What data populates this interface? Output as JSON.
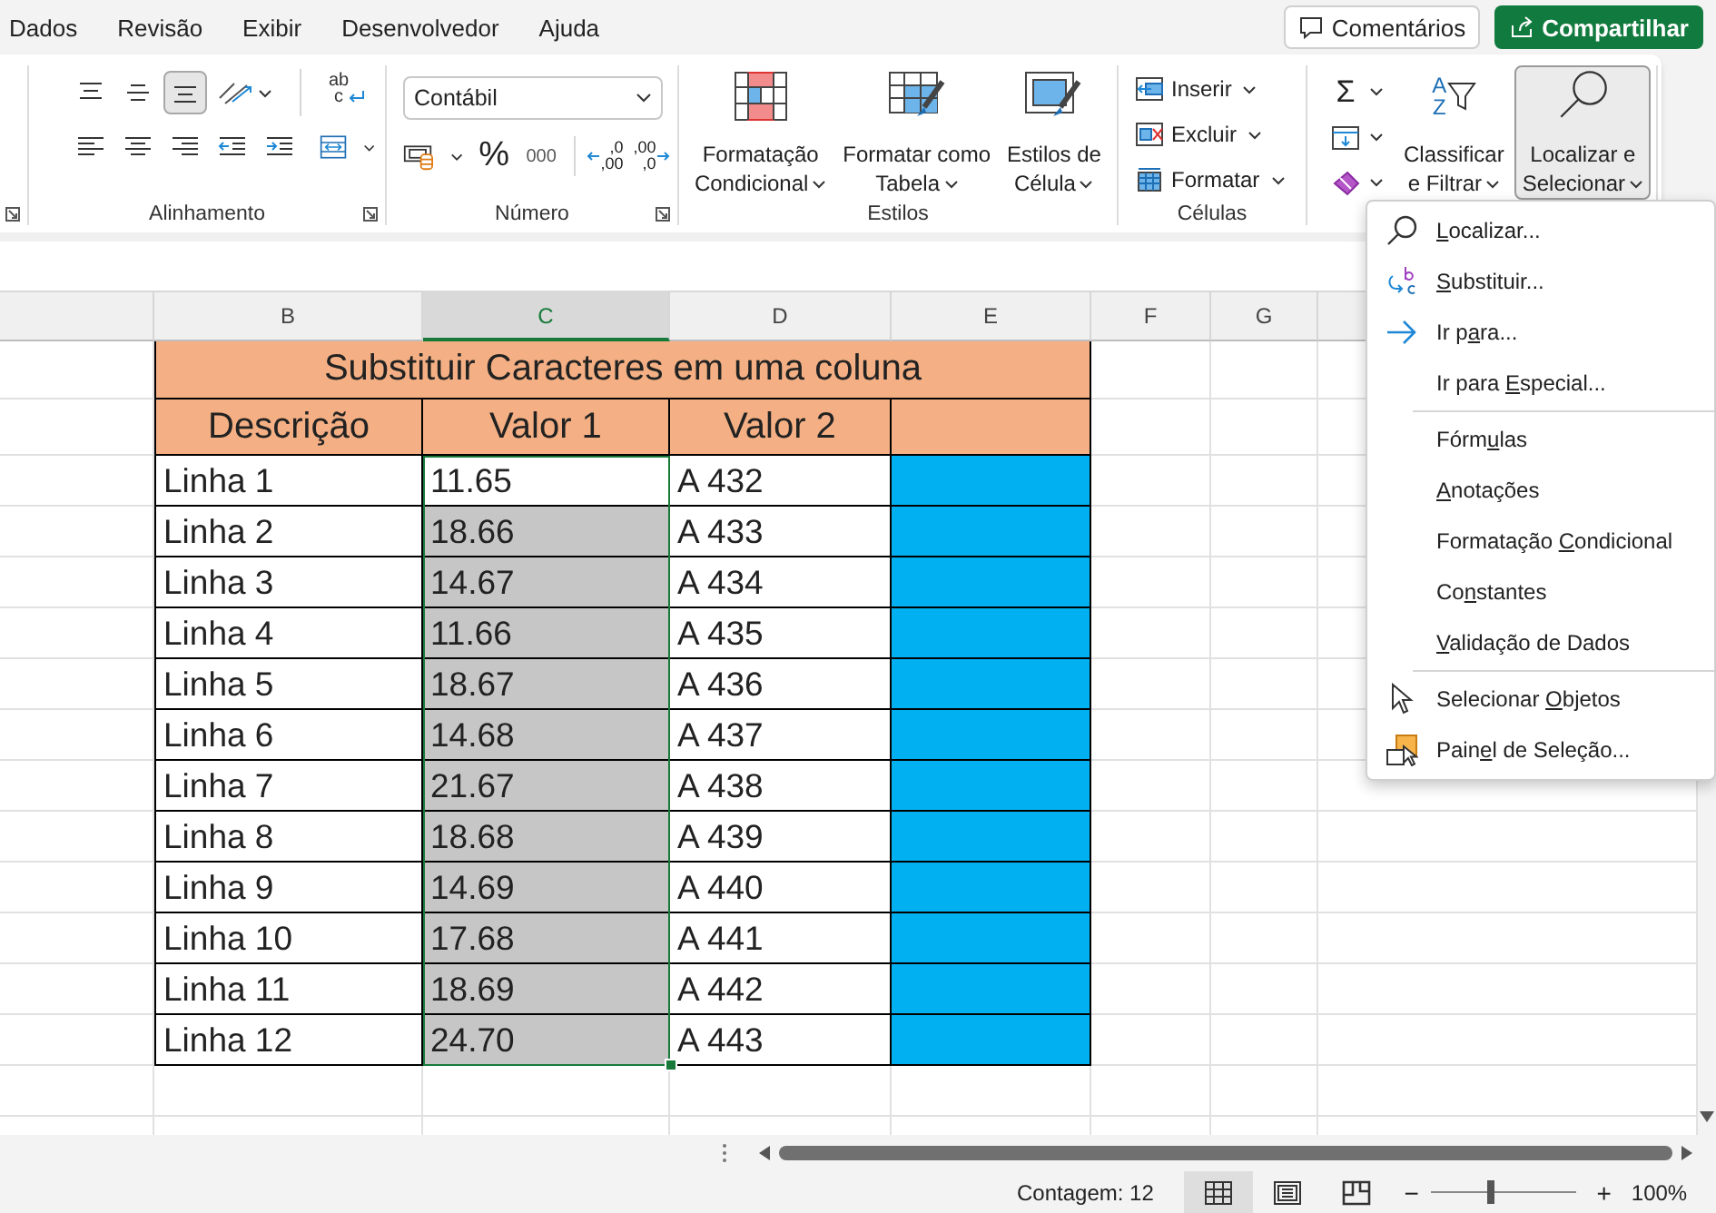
{
  "menu_tabs": [
    "Dados",
    "Revisão",
    "Exibir",
    "Desenvolvedor",
    "Ajuda"
  ],
  "top_buttons": [
    {
      "kind": "comments",
      "label": "Comentários"
    },
    {
      "kind": "share",
      "label": "Compartilhar"
    }
  ],
  "ribbon": {
    "alignment": {
      "label": "Alinhamento",
      "vertical": [
        {
          "selected": false
        },
        {
          "selected": false
        },
        {
          "selected": true
        }
      ],
      "wrap_glyph": [
        "ab",
        "c"
      ]
    },
    "number": {
      "label": "Número",
      "format": "Contábil",
      "percent": "%",
      "thousands": "000",
      "increase_decimal": [
        ",0",
        ",00"
      ],
      "decrease_decimal": [
        ",00",
        ",0"
      ]
    },
    "styles": {
      "label": "Estilos",
      "buttons": [
        {
          "kind": "conditional",
          "lines": [
            "Formatação",
            "Condicional"
          ]
        },
        {
          "kind": "table",
          "lines": [
            "Formatar como",
            "Tabela"
          ]
        },
        {
          "kind": "cell",
          "lines": [
            "Estilos de",
            "Célula"
          ]
        }
      ]
    },
    "cells": {
      "label": "Células",
      "buttons": [
        {
          "kind": "insert",
          "label": "Inserir"
        },
        {
          "kind": "delete",
          "label": "Excluir"
        },
        {
          "kind": "format",
          "label": "Formatar"
        }
      ]
    },
    "editing": {
      "sum_glyph": "Σ",
      "sort_glyph": [
        "A",
        "Z"
      ],
      "buttons": [
        {
          "kind": "sort",
          "lines": [
            "Classificar",
            "e Filtrar"
          ],
          "expanded": false
        },
        {
          "kind": "find",
          "lines": [
            "Localizar e",
            "Selecionar"
          ],
          "expanded": true
        }
      ]
    }
  },
  "sheet": {
    "columns": [
      {
        "label": "B",
        "selected": false
      },
      {
        "label": "C",
        "selected": true
      },
      {
        "label": "D",
        "selected": false
      },
      {
        "label": "E",
        "selected": false
      },
      {
        "label": "F",
        "selected": false
      },
      {
        "label": "G",
        "selected": false
      }
    ],
    "title": "Substituir Caracteres em uma coluna",
    "headers": [
      "Descrição",
      "Valor 1",
      "Valor 2"
    ],
    "rows": [
      {
        "desc": "Linha 1",
        "v1": "11.65",
        "v2": "A 432",
        "active": true
      },
      {
        "desc": "Linha 2",
        "v1": "18.66",
        "v2": "A 433",
        "active": false
      },
      {
        "desc": "Linha 3",
        "v1": "14.67",
        "v2": "A 434",
        "active": false
      },
      {
        "desc": "Linha 4",
        "v1": "11.66",
        "v2": "A 435",
        "active": false
      },
      {
        "desc": "Linha 5",
        "v1": "18.67",
        "v2": "A 436",
        "active": false
      },
      {
        "desc": "Linha 6",
        "v1": "14.68",
        "v2": "A 437",
        "active": false
      },
      {
        "desc": "Linha 7",
        "v1": "21.67",
        "v2": "A 438",
        "active": false
      },
      {
        "desc": "Linha 8",
        "v1": "18.68",
        "v2": "A 439",
        "active": false
      },
      {
        "desc": "Linha 9",
        "v1": "14.69",
        "v2": "A 440",
        "active": false
      },
      {
        "desc": "Linha 10",
        "v1": "17.68",
        "v2": "A 441",
        "active": false
      },
      {
        "desc": "Linha 11",
        "v1": "18.69",
        "v2": "A 442",
        "active": false
      },
      {
        "desc": "Linha 12",
        "v1": "24.70",
        "v2": "A 443",
        "active": false
      }
    ]
  },
  "dropdown": {
    "sections": [
      [
        {
          "key": "L",
          "after": "ocalizar..."
        },
        {
          "key": "S",
          "after": "ubstituir..."
        },
        {
          "before": "Ir p",
          "key": "a",
          "after": "ra..."
        },
        {
          "before": "Ir para ",
          "key": "E",
          "after": "special..."
        }
      ],
      [
        {
          "before": "Fórm",
          "key": "u",
          "after": "las"
        },
        {
          "key": "A",
          "after": "notações"
        },
        {
          "before": "Formatação ",
          "key": "C",
          "after": "ondicional"
        },
        {
          "before": "Co",
          "key": "n",
          "after": "stantes"
        },
        {
          "key": "V",
          "after": "alidação de Dados"
        }
      ],
      [
        {
          "before": "Selecionar ",
          "key": "O",
          "after": "bjetos"
        },
        {
          "before": "Pain",
          "key": "e",
          "after": "l de Seleção..."
        }
      ]
    ]
  },
  "status_bar": {
    "count": "Contagem: 12",
    "views": [
      {
        "kind": "normal",
        "selected": true
      },
      {
        "kind": "page_layout",
        "selected": false
      },
      {
        "kind": "page_break",
        "selected": false
      }
    ],
    "zoom_out": "−",
    "zoom_in": "+",
    "zoom": "100%",
    "zoom_slider": {
      "level": 0.41
    }
  }
}
